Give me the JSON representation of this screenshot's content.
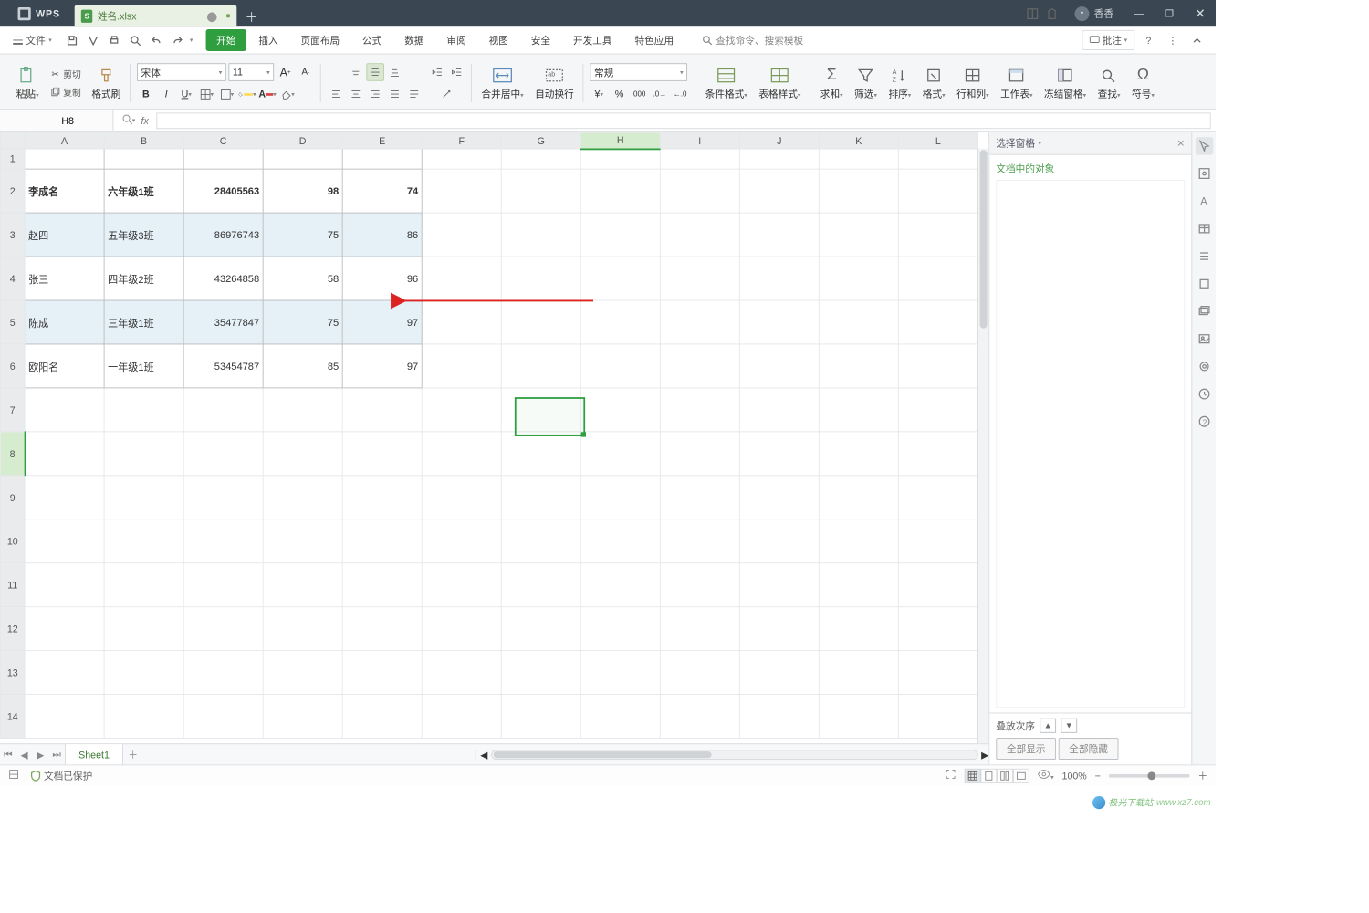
{
  "app": {
    "brand": "WPS",
    "doc_name": "姓名.xlsx",
    "user": "香香"
  },
  "win": {
    "min": "—",
    "max": "❐",
    "close": "✕"
  },
  "file_menu": "文件",
  "tabs": [
    "开始",
    "插入",
    "页面布局",
    "公式",
    "数据",
    "审阅",
    "视图",
    "安全",
    "开发工具",
    "特色应用"
  ],
  "active_tab_index": 0,
  "search_placeholder": "查找命令、搜索模板",
  "annotate": "批注",
  "ribbon": {
    "clipboard": {
      "paste": "粘贴",
      "cut": "剪切",
      "copy": "复制",
      "format_painter": "格式刷"
    },
    "font": {
      "name": "宋体",
      "size": "11",
      "increase": "A",
      "decrease": "A"
    },
    "merge": "合并居中",
    "wrap": "自动换行",
    "number": {
      "format": "常规"
    },
    "cond": "条件格式",
    "style": "表格样式",
    "sum": "求和",
    "filter": "筛选",
    "sort": "排序",
    "fmt": "格式",
    "rowcol": "行和列",
    "ws": "工作表",
    "freeze": "冻结窗格",
    "find": "查找",
    "symbol": "符号"
  },
  "namebox": "H8",
  "columns": [
    "A",
    "B",
    "C",
    "D",
    "E",
    "F",
    "G",
    "H",
    "I",
    "J",
    "K",
    "L"
  ],
  "selected_col": "H",
  "selected_row": 8,
  "sheet_rows": [
    {
      "n": 1,
      "A": "",
      "B": "",
      "C": "",
      "D": "",
      "E": "",
      "bordered": true,
      "shade": false,
      "bold": false,
      "tall": false
    },
    {
      "n": 2,
      "A": "李成名",
      "B": "六年级1班",
      "C": "28405563",
      "D": "98",
      "E": "74",
      "bordered": true,
      "shade": false,
      "bold": true,
      "tall": true
    },
    {
      "n": 3,
      "A": "赵四",
      "B": "五年级3班",
      "C": "86976743",
      "D": "75",
      "E": "86",
      "bordered": true,
      "shade": true,
      "bold": false,
      "tall": true
    },
    {
      "n": 4,
      "A": "张三",
      "B": "四年级2班",
      "C": "43264858",
      "D": "58",
      "E": "96",
      "bordered": true,
      "shade": false,
      "bold": false,
      "tall": true
    },
    {
      "n": 5,
      "A": "陈成",
      "B": "三年级1班",
      "C": "35477847",
      "D": "75",
      "E": "97",
      "bordered": true,
      "shade": true,
      "bold": false,
      "tall": true
    },
    {
      "n": 6,
      "A": "欧阳名",
      "B": "一年级1班",
      "C": "53454787",
      "D": "85",
      "E": "97",
      "bordered": true,
      "shade": false,
      "bold": false,
      "tall": true
    }
  ],
  "blank_rows": [
    7,
    8,
    9,
    10,
    11,
    12,
    13,
    14
  ],
  "pane": {
    "title": "选择窗格",
    "sub": "文档中的对象",
    "stack": "叠放次序",
    "show_all": "全部显示",
    "hide_all": "全部隐藏"
  },
  "sheet_tab": "Sheet1",
  "status": {
    "protect": "文档已保护",
    "zoom": "100%"
  },
  "watermark": {
    "site": "www.xz7.com",
    "brand": "极光下载站"
  }
}
